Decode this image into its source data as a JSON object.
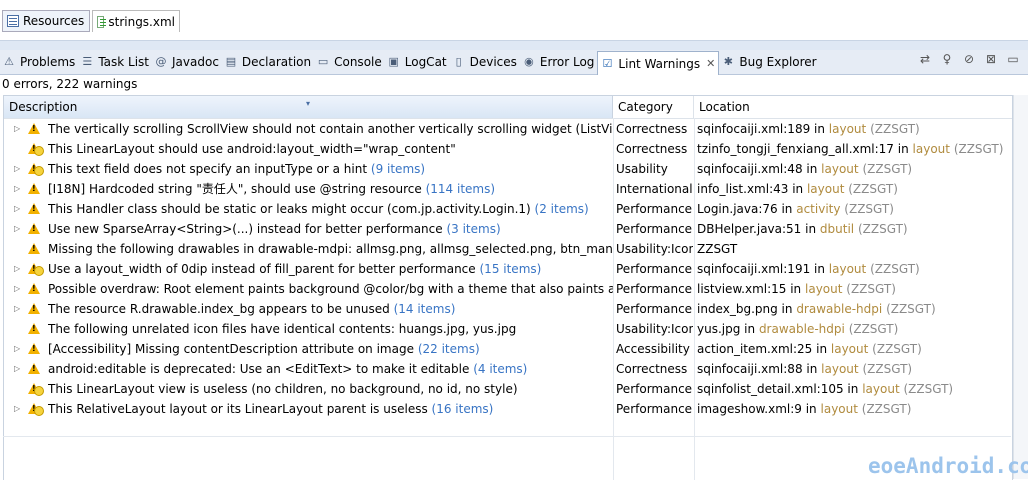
{
  "editor_tabs": [
    {
      "label": "Resources",
      "icon": "resources-icon"
    },
    {
      "label": "strings.xml",
      "icon": "xml-file-icon"
    }
  ],
  "view_tabs": [
    {
      "label": "Problems",
      "icon": "problems-icon",
      "glyph": "⚠"
    },
    {
      "label": "Task List",
      "icon": "task-list-icon",
      "glyph": "☰"
    },
    {
      "label": "Javadoc",
      "icon": "javadoc-icon",
      "glyph": "@"
    },
    {
      "label": "Declaration",
      "icon": "declaration-icon",
      "glyph": "▤"
    },
    {
      "label": "Console",
      "icon": "console-icon",
      "glyph": "▭"
    },
    {
      "label": "LogCat",
      "icon": "logcat-icon",
      "glyph": "▣"
    },
    {
      "label": "Devices",
      "icon": "devices-icon",
      "glyph": "▯"
    },
    {
      "label": "Error Log",
      "icon": "error-log-icon",
      "glyph": "◉"
    },
    {
      "label": "Lint Warnings",
      "icon": "lint-warnings-icon",
      "glyph": "☑",
      "active": true,
      "close": "✕"
    },
    {
      "label": "Bug Explorer",
      "icon": "bug-explorer-icon",
      "glyph": "✱"
    }
  ],
  "toolbar_icons": [
    "refresh-icon",
    "lightbulb-icon",
    "ignore-icon",
    "remove-icon",
    "minimize-icon"
  ],
  "summary": "0 errors, 222 warnings",
  "columns": {
    "description": "Description",
    "category": "Category",
    "location": "Location"
  },
  "sort_mark": "▾",
  "rows": [
    {
      "expand": true,
      "icon": "warning",
      "desc": "The vertically scrolling ScrollView should not contain another vertically scrolling widget (ListView)",
      "count": "",
      "category": "Correctness",
      "file": "sqinfocaiji.xml:189 in",
      "folder": "layout",
      "project": "(ZZSGT)"
    },
    {
      "expand": false,
      "icon": "hint",
      "desc": "This LinearLayout should use android:layout_width=\"wrap_content\"",
      "count": "",
      "category": "Correctness",
      "file": "tzinfo_tongji_fenxiang_all.xml:17 in",
      "folder": "layout",
      "project": "(ZZSGT)"
    },
    {
      "expand": true,
      "icon": "hint",
      "desc": "This text field does not specify an inputType or a hint",
      "count": "(9 items)",
      "category": "Usability",
      "file": "sqinfocaiji.xml:48 in",
      "folder": "layout",
      "project": "(ZZSGT)"
    },
    {
      "expand": true,
      "icon": "warning",
      "desc": "[I18N] Hardcoded string \"责任人\", should use @string resource",
      "count": "(114 items)",
      "category": "Internationali",
      "file": "info_list.xml:43 in",
      "folder": "layout",
      "project": "(ZZSGT)"
    },
    {
      "expand": true,
      "icon": "warning",
      "desc": "This Handler class should be static or leaks might occur (com.jp.activity.Login.1)",
      "count": "(2 items)",
      "category": "Performance",
      "file": "Login.java:76 in",
      "folder": "activity",
      "project": "(ZZSGT)"
    },
    {
      "expand": true,
      "icon": "warning",
      "desc": "Use new SparseArray<String>(...) instead for better performance",
      "count": "(3 items)",
      "category": "Performance",
      "file": "DBHelper.java:51 in",
      "folder": "dbutil",
      "project": "(ZZSGT)"
    },
    {
      "expand": false,
      "icon": "warning",
      "desc": "Missing the following drawables in drawable-mdpi: allmsg.png, allmsg_selected.png, btn_manage",
      "count": "",
      "category": "Usability:Icon",
      "file": "ZZSGT",
      "folder": "",
      "project": ""
    },
    {
      "expand": true,
      "icon": "hint",
      "desc": "Use a layout_width of 0dip instead of fill_parent for better performance",
      "count": "(15 items)",
      "category": "Performance",
      "file": "sqinfocaiji.xml:191 in",
      "folder": "layout",
      "project": "(ZZSGT)"
    },
    {
      "expand": true,
      "icon": "warning",
      "desc": "Possible overdraw: Root element paints background @color/bg with a theme that also paints a b",
      "count": "",
      "category": "Performance",
      "file": "listview.xml:15 in",
      "folder": "layout",
      "project": "(ZZSGT)"
    },
    {
      "expand": true,
      "icon": "warning",
      "desc": "The resource R.drawable.index_bg appears to be unused",
      "count": "(14 items)",
      "category": "Performance",
      "file": "index_bg.png in",
      "folder": "drawable-hdpi",
      "project": "(ZZSGT)"
    },
    {
      "expand": false,
      "icon": "warning",
      "desc": "The following unrelated icon files have identical contents: huangs.jpg, yus.jpg",
      "count": "",
      "category": "Usability:Icon",
      "file": "yus.jpg in",
      "folder": "drawable-hdpi",
      "project": "(ZZSGT)"
    },
    {
      "expand": true,
      "icon": "warning",
      "desc": "[Accessibility] Missing contentDescription attribute on image",
      "count": "(22 items)",
      "category": "Accessibility",
      "file": "action_item.xml:25 in",
      "folder": "layout",
      "project": "(ZZSGT)"
    },
    {
      "expand": true,
      "icon": "warning",
      "desc": "android:editable is deprecated: Use an <EditText> to make it editable",
      "count": "(4 items)",
      "category": "Correctness",
      "file": "sqinfocaiji.xml:88 in",
      "folder": "layout",
      "project": "(ZZSGT)"
    },
    {
      "expand": false,
      "icon": "hint",
      "desc": "This LinearLayout view is useless (no children, no background, no id, no style)",
      "count": "",
      "category": "Performance",
      "file": "sqinfolist_detail.xml:105 in",
      "folder": "layout",
      "project": "(ZZSGT)"
    },
    {
      "expand": true,
      "icon": "hint",
      "desc": "This RelativeLayout layout or its LinearLayout parent is useless",
      "count": "(16 items)",
      "category": "Performance",
      "file": "imageshow.xml:9 in",
      "folder": "layout",
      "project": "(ZZSGT)"
    }
  ],
  "watermark": "eoeAndroid.com"
}
